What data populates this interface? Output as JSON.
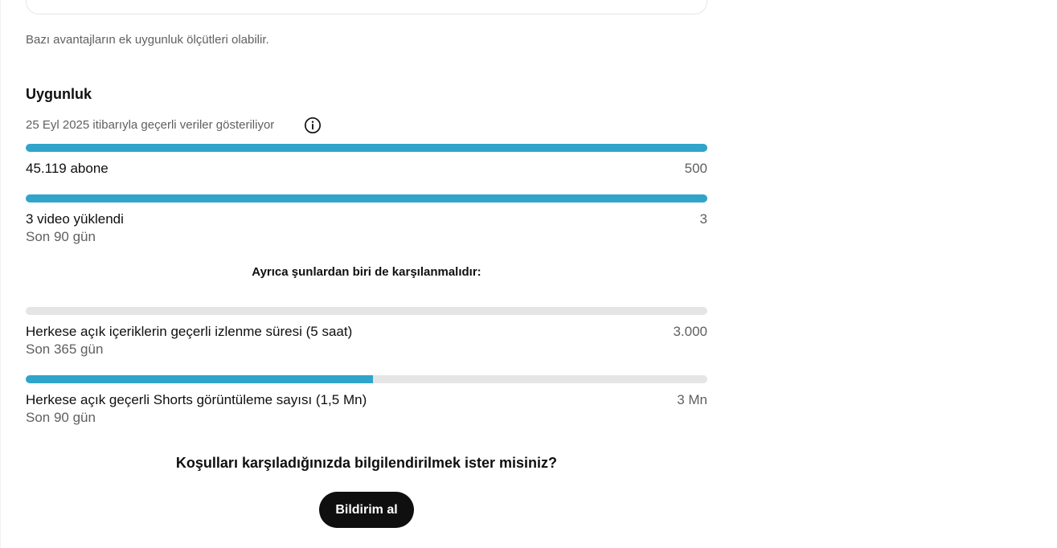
{
  "note": "Bazı avantajların ek uygunluk ölçütleri olabilir.",
  "eligibility": {
    "title": "Uygunluk",
    "data_date": "25 Eyl 2025 itibarıyla geçerli veriler gösteriliyor",
    "info_icon": "info-icon",
    "requirements": [
      {
        "label": "45.119 abone",
        "target": "500",
        "progress": 1.0
      },
      {
        "label": "3 video yüklendi",
        "period": "Son 90 gün",
        "target": "3",
        "progress": 1.0
      }
    ],
    "also_text": "Ayrıca şunlardan biri de karşılanmalıdır:",
    "alternatives": [
      {
        "label": "Herkese açık içeriklerin geçerli izlenme süresi (5 saat)",
        "period": "Son 365 gün",
        "target": "3.000",
        "progress": 0.0
      },
      {
        "label": "Herkese açık geçerli Shorts görüntüleme sayısı (1,5 Mn)",
        "period": "Son 90 gün",
        "target": "3 Mn",
        "progress": 0.51
      }
    ]
  },
  "notify": {
    "question": "Koşulları karşıladığınızda bilgilendirilmek ister misiniz?",
    "button_label": "Bildirim al"
  },
  "colors": {
    "progress_fill": "#30a4ca",
    "progress_track": "#e5e5e5",
    "button_bg": "#0f0f0f"
  }
}
